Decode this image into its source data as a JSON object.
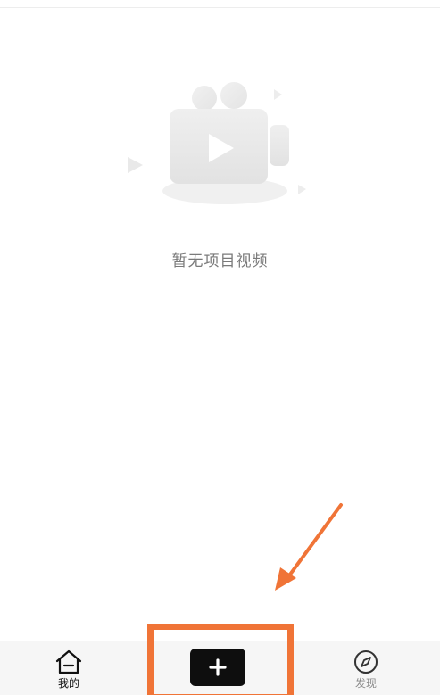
{
  "empty_state": {
    "message": "暂无项目视频",
    "illustration": "video-camera-play-icon"
  },
  "tabbar": {
    "tabs": [
      {
        "key": "mine",
        "label": "我的",
        "icon": "home-icon",
        "active": true
      },
      {
        "key": "create",
        "icon": "plus-icon"
      },
      {
        "key": "discover",
        "label": "发现",
        "icon": "compass-icon",
        "active": false
      }
    ]
  },
  "colors": {
    "annotation": "#f07437",
    "create_button": "#0e0e0e",
    "tabbar_bg": "#f6f6f6",
    "empty_text": "#7a7a7a"
  }
}
